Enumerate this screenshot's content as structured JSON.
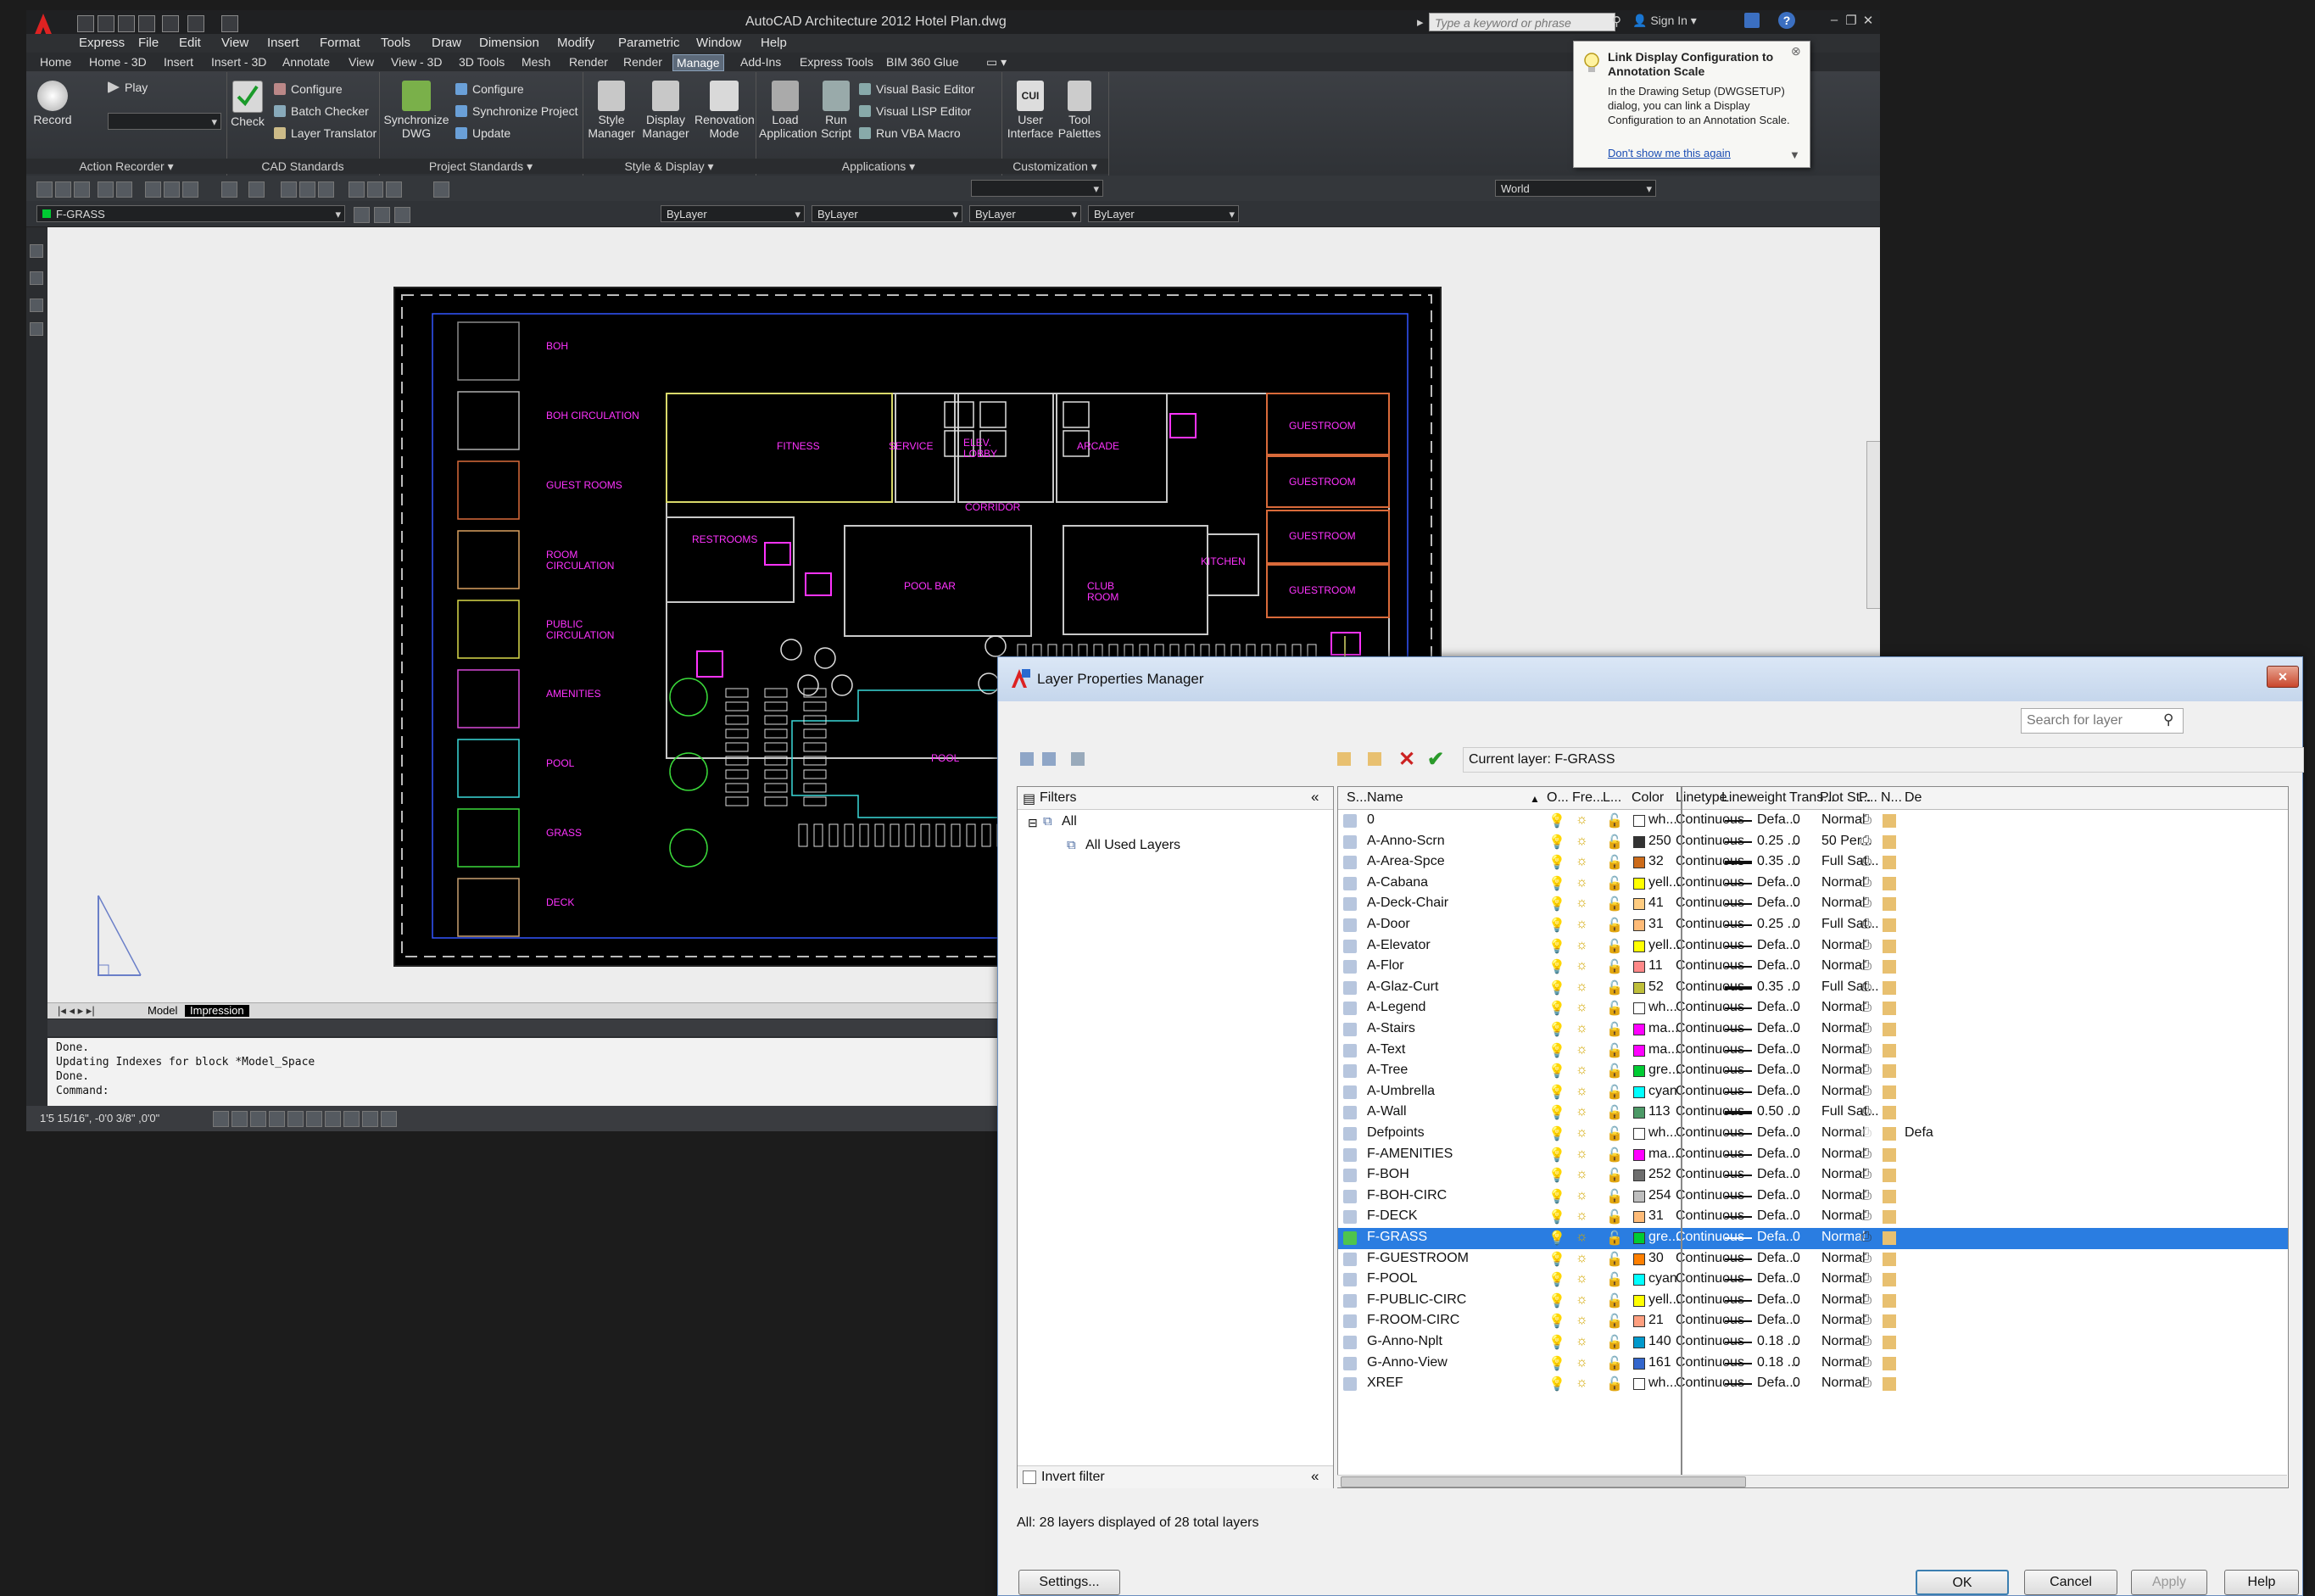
{
  "app": {
    "title": "AutoCAD Architecture 2012    Hotel Plan.dwg",
    "search_placeholder": "Type a keyword or phrase",
    "signin": "Sign In"
  },
  "menus": [
    "Express",
    "File",
    "Edit",
    "View",
    "Insert",
    "Format",
    "Tools",
    "Draw",
    "Dimension",
    "Modify",
    "Parametric",
    "Window",
    "Help"
  ],
  "ribbon_tabs": [
    "Home",
    "Home - 3D",
    "Insert",
    "Insert - 3D",
    "Annotate",
    "View",
    "View - 3D",
    "3D Tools",
    "Mesh",
    "Render",
    "Render",
    "Manage",
    "Add-Ins",
    "Express Tools",
    "BIM 360 Glue"
  ],
  "active_tab": "Manage",
  "ribbon": {
    "action_recorder": {
      "record": "Record",
      "play": "Play",
      "title": "Action Recorder"
    },
    "cad_standards": {
      "check": "Check",
      "configure": "Configure",
      "batch": "Batch Checker",
      "translator": "Layer Translator",
      "title": "CAD Standards"
    },
    "project_standards": {
      "sync_dwg": "Synchronize DWG",
      "configure": "Configure",
      "sync_project": "Synchronize Project",
      "update": "Update",
      "title": "Project Standards"
    },
    "style_display": {
      "style": "Style Manager",
      "display": "Display Manager",
      "renovation": "Renovation Mode",
      "title": "Style & Display"
    },
    "applications": {
      "load": "Load Application",
      "run": "Run Script",
      "vb": "Visual Basic Editor",
      "lisp": "Visual LISP Editor",
      "vba": "Run VBA Macro",
      "title": "Applications"
    },
    "customization": {
      "ui": "User Interface",
      "palettes": "Tool Palettes",
      "title": "Customization"
    }
  },
  "toolbar": {
    "ucs_combo": "World",
    "layer_combo": "F-GRASS",
    "color_combo": "ByLayer",
    "linetype_combo": "ByLayer",
    "lineweight_combo": "ByLayer",
    "plotstyle_combo": "ByLayer"
  },
  "drawing": {
    "legend": [
      "BOH",
      "BOH CIRCULATION",
      "GUEST ROOMS",
      "ROOM CIRCULATION",
      "PUBLIC CIRCULATION",
      "AMENITIES",
      "POOL",
      "GRASS",
      "DECK"
    ],
    "legend_colors": [
      "#8a8a8a",
      "#b0b0b0",
      "#d96a3a",
      "#d9a060",
      "#d9d94a",
      "#d94ad9",
      "#3ad9d9",
      "#3ad93a",
      "#c8a070"
    ],
    "rooms": [
      "FITNESS",
      "SERVICE",
      "ELEV. LOBBY",
      "ARCADE",
      "GUESTROOM",
      "GUESTROOM",
      "GUESTROOM",
      "GUESTROOM",
      "CORRIDOR",
      "RESTROOMS",
      "POOL BAR",
      "CLUB ROOM",
      "KITCHEN",
      "POOL"
    ]
  },
  "layout_tabs": [
    "Model",
    "Impression"
  ],
  "command_lines": [
    "Done.",
    "Updating Indexes for block *Model_Space",
    "Done.",
    "Command:"
  ],
  "status": {
    "coords": "1'5 15/16\", -0'0 3/8\" ,0'0\""
  },
  "tooltip": {
    "title": "Link Display Configuration to Annotation Scale",
    "body": "In the Drawing Setup (DWGSETUP) dialog, you can link a Display Configuration to an Annotation Scale.",
    "link": "Don't show me this again"
  },
  "lpm": {
    "title": "Layer Properties Manager",
    "search_placeholder": "Search for layer",
    "current_layer": "Current layer: F-GRASS",
    "filters_title": "Filters",
    "filter_all": "All",
    "filter_used": "All Used Layers",
    "invert_filter": "Invert filter",
    "status_text": "All: 28 layers displayed of 28 total layers",
    "columns": [
      "S...",
      "Name",
      "O...",
      "Fre...",
      "L...",
      "Color",
      "Linetype",
      "Lineweight",
      "Trans...",
      "Plot St...",
      "P...",
      "N...",
      "De"
    ],
    "buttons": {
      "settings": "Settings...",
      "ok": "OK",
      "cancel": "Cancel",
      "apply": "Apply",
      "help": "Help"
    },
    "layers": [
      {
        "name": "0",
        "color": "wh...",
        "hex": "#ffffff",
        "linetype": "Continuous",
        "lw": "Defa...",
        "trans": "0",
        "plot": "Normal"
      },
      {
        "name": "A-Anno-Scrn",
        "color": "250",
        "hex": "#333333",
        "linetype": "Continuous",
        "lw": "0.25 ...",
        "trans": "0",
        "plot": "50 Per..."
      },
      {
        "name": "A-Area-Spce",
        "color": "32",
        "hex": "#cc6b1a",
        "linetype": "Continuous",
        "lw": "0.35 ...",
        "trans": "0",
        "plot": "Full Sat..."
      },
      {
        "name": "A-Cabana",
        "color": "yell...",
        "hex": "#ffff00",
        "linetype": "Continuous",
        "lw": "Defa...",
        "trans": "0",
        "plot": "Normal"
      },
      {
        "name": "A-Deck-Chair",
        "color": "41",
        "hex": "#ffcc80",
        "linetype": "Continuous",
        "lw": "Defa...",
        "trans": "0",
        "plot": "Normal"
      },
      {
        "name": "A-Door",
        "color": "31",
        "hex": "#ffbb77",
        "linetype": "Continuous",
        "lw": "0.25 ...",
        "trans": "0",
        "plot": "Full Sat..."
      },
      {
        "name": "A-Elevator",
        "color": "yell...",
        "hex": "#ffff00",
        "linetype": "Continuous",
        "lw": "Defa...",
        "trans": "0",
        "plot": "Normal"
      },
      {
        "name": "A-Flor",
        "color": "11",
        "hex": "#ff8888",
        "linetype": "Continuous",
        "lw": "Defa...",
        "trans": "0",
        "plot": "Normal"
      },
      {
        "name": "A-Glaz-Curt",
        "color": "52",
        "hex": "#bfbf3a",
        "linetype": "Continuous",
        "lw": "0.35 ...",
        "trans": "0",
        "plot": "Full Sat..."
      },
      {
        "name": "A-Legend",
        "color": "wh...",
        "hex": "#ffffff",
        "linetype": "Continuous",
        "lw": "Defa...",
        "trans": "0",
        "plot": "Normal"
      },
      {
        "name": "A-Stairs",
        "color": "ma...",
        "hex": "#ff00ff",
        "linetype": "Continuous",
        "lw": "Defa...",
        "trans": "0",
        "plot": "Normal"
      },
      {
        "name": "A-Text",
        "color": "ma...",
        "hex": "#ff00ff",
        "linetype": "Continuous",
        "lw": "Defa...",
        "trans": "0",
        "plot": "Normal"
      },
      {
        "name": "A-Tree",
        "color": "gre...",
        "hex": "#00cc33",
        "linetype": "Continuous",
        "lw": "Defa...",
        "trans": "0",
        "plot": "Normal"
      },
      {
        "name": "A-Umbrella",
        "color": "cyan",
        "hex": "#00ffff",
        "linetype": "Continuous",
        "lw": "Defa...",
        "trans": "0",
        "plot": "Normal"
      },
      {
        "name": "A-Wall",
        "color": "113",
        "hex": "#4c9966",
        "linetype": "Continuous",
        "lw": "0.50 ...",
        "trans": "0",
        "plot": "Full Sat..."
      },
      {
        "name": "Defpoints",
        "color": "wh...",
        "hex": "#ffffff",
        "linetype": "Continuous",
        "lw": "Defa...",
        "trans": "0",
        "plot": "Normal"
      },
      {
        "name": "F-AMENITIES",
        "color": "ma...",
        "hex": "#ff00ff",
        "linetype": "Continuous",
        "lw": "Defa...",
        "trans": "0",
        "plot": "Normal"
      },
      {
        "name": "F-BOH",
        "color": "252",
        "hex": "#6e6e6e",
        "linetype": "Continuous",
        "lw": "Defa...",
        "trans": "0",
        "plot": "Normal"
      },
      {
        "name": "F-BOH-CIRC",
        "color": "254",
        "hex": "#bebebe",
        "linetype": "Continuous",
        "lw": "Defa...",
        "trans": "0",
        "plot": "Normal"
      },
      {
        "name": "F-DECK",
        "color": "31",
        "hex": "#ffbb77",
        "linetype": "Continuous",
        "lw": "Defa...",
        "trans": "0",
        "plot": "Normal"
      },
      {
        "name": "F-GRASS",
        "color": "gre...",
        "hex": "#00cc33",
        "linetype": "Continuous",
        "lw": "Defa...",
        "trans": "0",
        "plot": "Normal"
      },
      {
        "name": "F-GUESTROOM",
        "color": "30",
        "hex": "#ff7f00",
        "linetype": "Continuous",
        "lw": "Defa...",
        "trans": "0",
        "plot": "Normal"
      },
      {
        "name": "F-POOL",
        "color": "cyan",
        "hex": "#00ffff",
        "linetype": "Continuous",
        "lw": "Defa...",
        "trans": "0",
        "plot": "Normal"
      },
      {
        "name": "F-PUBLIC-CIRC",
        "color": "yell...",
        "hex": "#ffff00",
        "linetype": "Continuous",
        "lw": "Defa...",
        "trans": "0",
        "plot": "Normal"
      },
      {
        "name": "F-ROOM-CIRC",
        "color": "21",
        "hex": "#ff9f7f",
        "linetype": "Continuous",
        "lw": "Defa...",
        "trans": "0",
        "plot": "Normal"
      },
      {
        "name": "G-Anno-Nplt",
        "color": "140",
        "hex": "#0099cc",
        "linetype": "Continuous",
        "lw": "0.18 ...",
        "trans": "0",
        "plot": "Normal"
      },
      {
        "name": "G-Anno-View",
        "color": "161",
        "hex": "#3366cc",
        "linetype": "Continuous",
        "lw": "0.18 ...",
        "trans": "0",
        "plot": "Normal"
      },
      {
        "name": "XREF",
        "color": "wh...",
        "hex": "#ffffff",
        "linetype": "Continuous",
        "lw": "Defa...",
        "trans": "0",
        "plot": "Normal"
      }
    ],
    "selected": "F-GRASS",
    "defpoints_desc": "Defa"
  }
}
